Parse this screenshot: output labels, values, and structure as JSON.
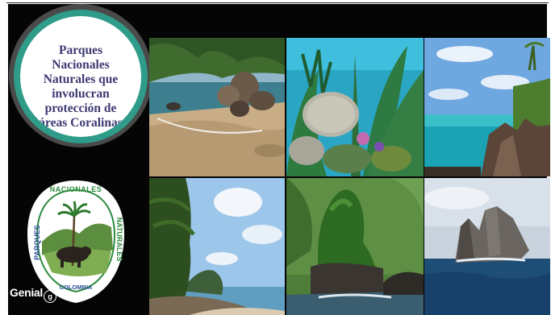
{
  "slide": {
    "title": "Parques\nNacionales\nNaturales que\ninvolucran\nprotección de\náreas Coralinas"
  },
  "logo": {
    "top_text": "NACIONALES",
    "left_text": "PARQUES",
    "right_text": "NATURALES",
    "bottom_text": "COLOMBIA"
  },
  "watermark": {
    "brand": "Genial"
  },
  "photos": [
    "beach-rocks-photo",
    "coral-reef-photo",
    "rocky-coast-photo",
    "palm-shore-photo",
    "jungle-rock-island-photo",
    "sea-rock-photo"
  ],
  "colors": {
    "background": "#050505",
    "title_text": "#3e3a73",
    "title_ring": "#2f9c8a",
    "logo_green": "#2e8b3e",
    "logo_blue": "#2a4f9e"
  }
}
